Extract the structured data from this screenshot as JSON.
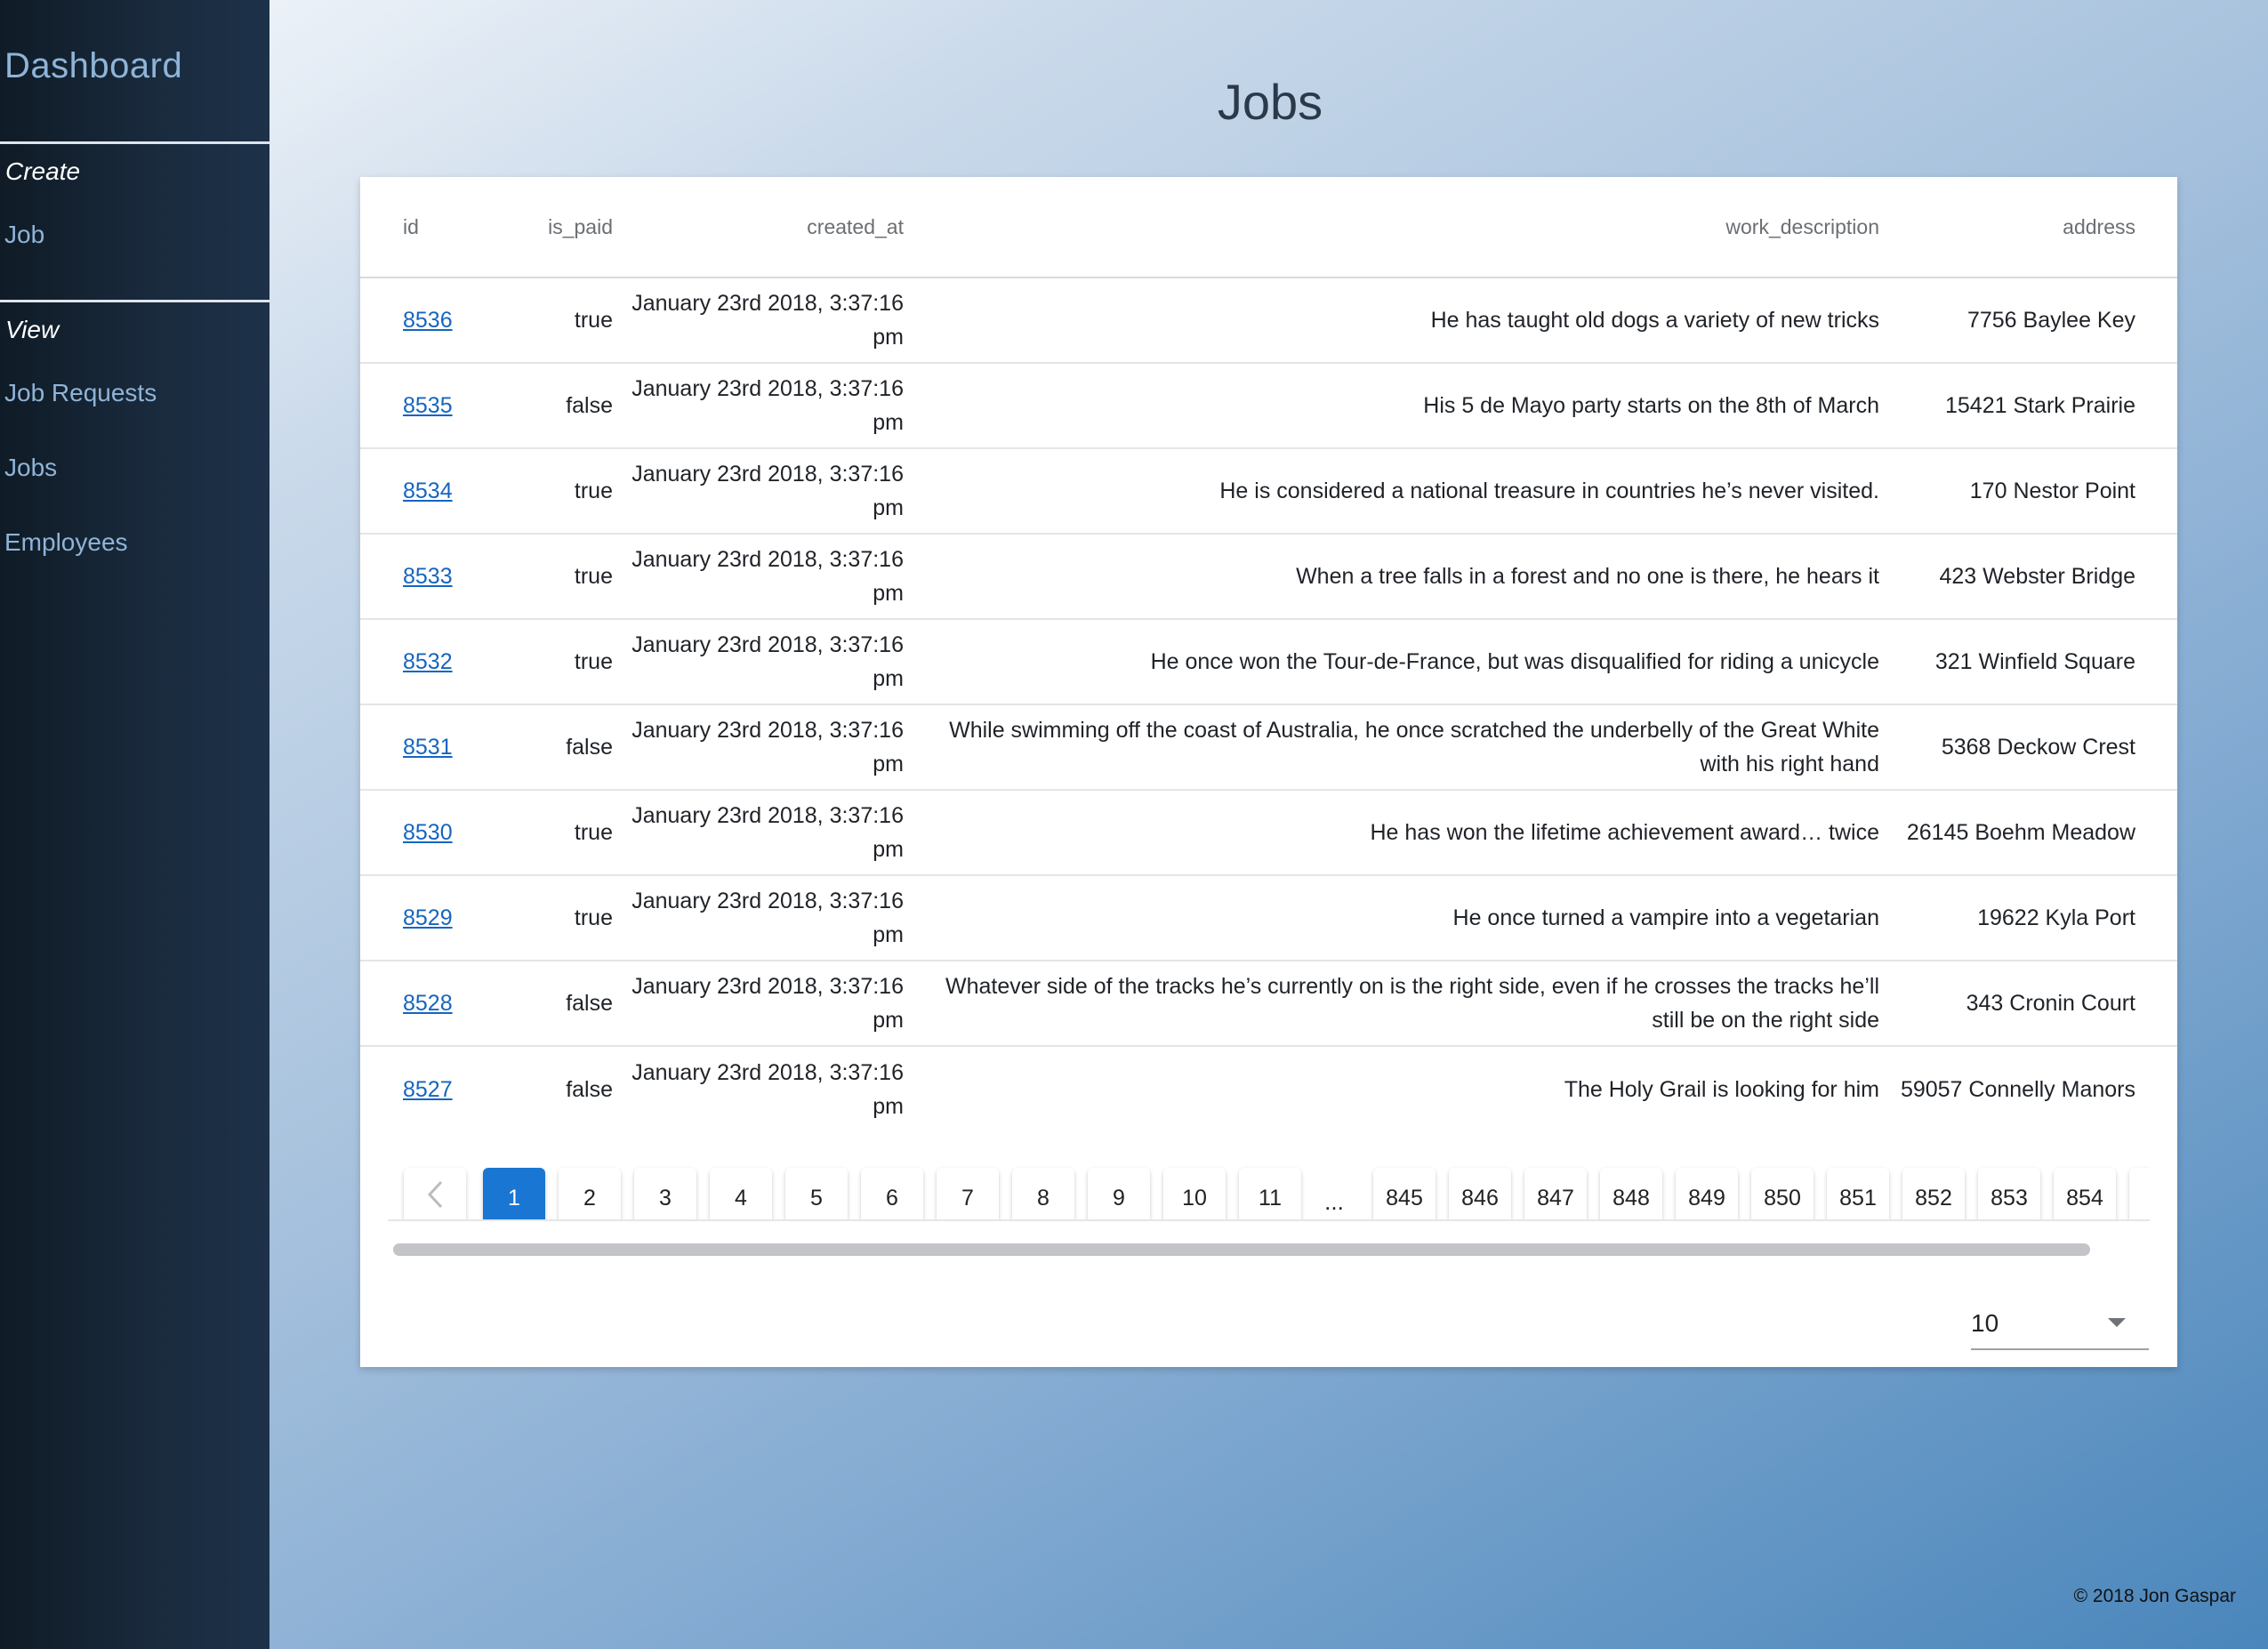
{
  "sidebar": {
    "title": "Dashboard",
    "create_label": "Create",
    "create_items": [
      {
        "label": "Job"
      }
    ],
    "view_label": "View",
    "view_items": [
      {
        "label": "Job Requests"
      },
      {
        "label": "Jobs"
      },
      {
        "label": "Employees"
      }
    ]
  },
  "page": {
    "title": "Jobs"
  },
  "table": {
    "columns": [
      "id",
      "is_paid",
      "created_at",
      "work_description",
      "address"
    ],
    "rows": [
      {
        "id": "8536",
        "is_paid": "true",
        "created_at": "January 23rd 2018, 3:37:16 pm",
        "work_description": "He has taught old dogs a variety of new tricks",
        "address": "7756 Baylee Key"
      },
      {
        "id": "8535",
        "is_paid": "false",
        "created_at": "January 23rd 2018, 3:37:16 pm",
        "work_description": "His 5 de Mayo party starts on the 8th of March",
        "address": "15421 Stark Prairie"
      },
      {
        "id": "8534",
        "is_paid": "true",
        "created_at": "January 23rd 2018, 3:37:16 pm",
        "work_description": "He is considered a national treasure in countries he’s never visited.",
        "address": "170 Nestor Point"
      },
      {
        "id": "8533",
        "is_paid": "true",
        "created_at": "January 23rd 2018, 3:37:16 pm",
        "work_description": "When a tree falls in a forest and no one is there, he hears it",
        "address": "423 Webster Bridge"
      },
      {
        "id": "8532",
        "is_paid": "true",
        "created_at": "January 23rd 2018, 3:37:16 pm",
        "work_description": "He once won the Tour-de-France, but was disqualified for riding a unicycle",
        "address": "321 Winfield Square"
      },
      {
        "id": "8531",
        "is_paid": "false",
        "created_at": "January 23rd 2018, 3:37:16 pm",
        "work_description": "While swimming off the coast of Australia, he once scratched the underbelly of the Great White with his right hand",
        "address": "5368 Deckow Crest"
      },
      {
        "id": "8530",
        "is_paid": "true",
        "created_at": "January 23rd 2018, 3:37:16 pm",
        "work_description": "He has won the lifetime achievement award… twice",
        "address": "26145 Boehm Meadow"
      },
      {
        "id": "8529",
        "is_paid": "true",
        "created_at": "January 23rd 2018, 3:37:16 pm",
        "work_description": "He once turned a vampire into a vegetarian",
        "address": "19622 Kyla Port"
      },
      {
        "id": "8528",
        "is_paid": "false",
        "created_at": "January 23rd 2018, 3:37:16 pm",
        "work_description": "Whatever side of the tracks he’s currently on is the right side, even if he crosses the tracks he’ll still be on the right side",
        "address": "343 Cronin Court"
      },
      {
        "id": "8527",
        "is_paid": "false",
        "created_at": "January 23rd 2018, 3:37:16 pm",
        "work_description": "The Holy Grail is looking for him",
        "address": "59057 Connelly Manors"
      }
    ]
  },
  "pagination": {
    "prev_icon": "chevron-left-icon",
    "active_page": "1",
    "pages_start": [
      "1",
      "2",
      "3",
      "4",
      "5",
      "6",
      "7",
      "8",
      "9",
      "10",
      "11"
    ],
    "ellipsis": "...",
    "pages_end": [
      "845",
      "846",
      "847",
      "848",
      "849",
      "850",
      "851",
      "852",
      "853",
      "854"
    ],
    "accent_color": "#1976d2"
  },
  "per_page": {
    "value": "10",
    "icon": "caret-down-icon"
  },
  "footer": {
    "text": "© 2018 Jon Gaspar"
  }
}
